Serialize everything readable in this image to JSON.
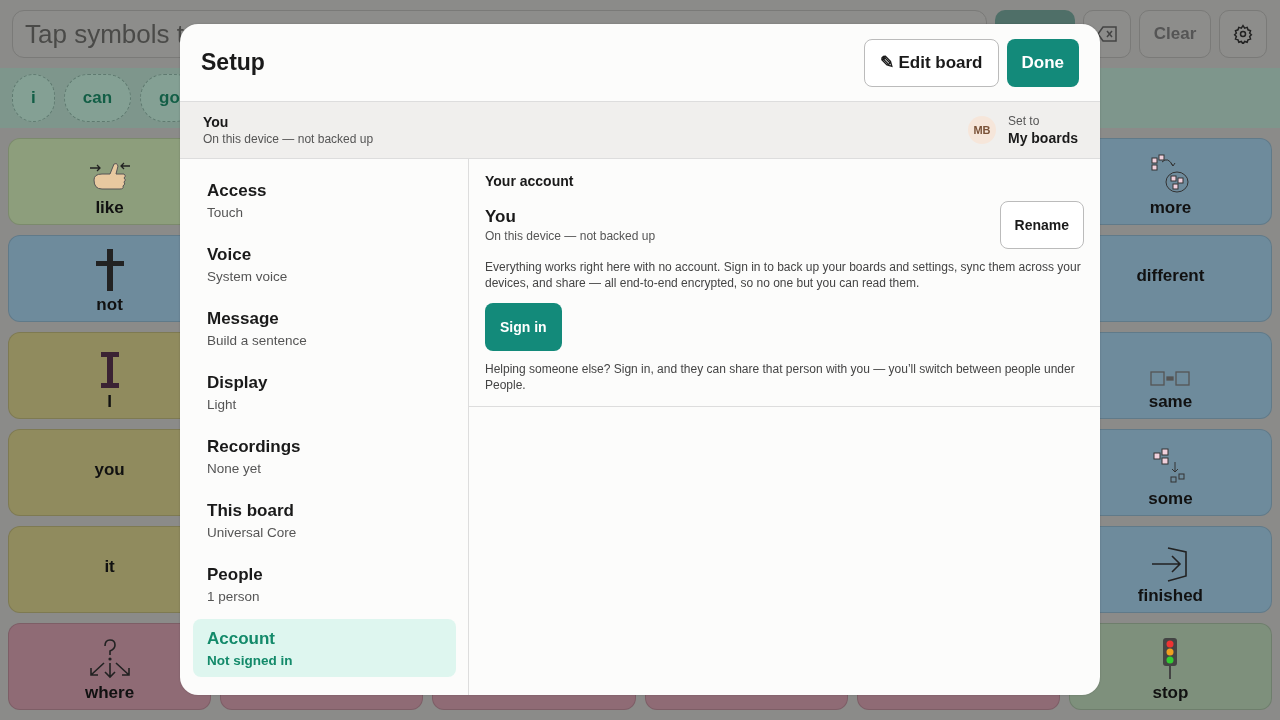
{
  "top_bar": {
    "message_placeholder": "Tap symbols t",
    "clear_button": "Clear"
  },
  "chips": [
    {
      "label": "i"
    },
    {
      "label": "can"
    },
    {
      "label": "go"
    }
  ],
  "board": {
    "rows": [
      {
        "tiles": [
          {
            "label": "like",
            "color": "#8d9e7c"
          },
          {
            "label": "more",
            "color": "#6e8b9c"
          }
        ]
      },
      {
        "tiles": [
          {
            "label": "not",
            "color": "#6e8b9c"
          },
          {
            "label": "different",
            "color": "#6e8b9c"
          }
        ]
      },
      {
        "tiles": [
          {
            "label": "I",
            "color": "#908b5e"
          },
          {
            "label": "same",
            "color": "#6e8b9c"
          }
        ]
      },
      {
        "tiles": [
          {
            "label": "you",
            "color": "#908b5e"
          },
          {
            "label": "some",
            "color": "#6e8b9c"
          }
        ]
      },
      {
        "tiles": [
          {
            "label": "it",
            "color": "#908b5e"
          },
          {
            "label": "finished",
            "color": "#6e8b9c"
          }
        ]
      },
      {
        "tiles": [
          {
            "label": "where",
            "color": "#8f6b75"
          },
          {
            "color": "#8f6b75"
          },
          {
            "color": "#8f6b75"
          },
          {
            "color": "#8f6b75"
          },
          {
            "color": "#8f6b75"
          },
          {
            "label": "stop",
            "color": "#7e907c"
          }
        ]
      }
    ]
  },
  "dialog": {
    "title": "Setup",
    "edit_button": {
      "icon": "✎",
      "label": "Edit board"
    },
    "done_button": "Done",
    "profile": {
      "name": "You",
      "status": "On this device — not backed up",
      "avatar": "MB",
      "set_to_label": "Set to",
      "set_to_value": "My boards"
    },
    "nav": [
      {
        "title": "Access",
        "subtitle": "Touch",
        "selected": false
      },
      {
        "title": "Voice",
        "subtitle": "System voice",
        "selected": false
      },
      {
        "title": "Message",
        "subtitle": "Build a sentence",
        "selected": false
      },
      {
        "title": "Display",
        "subtitle": "Light",
        "selected": false
      },
      {
        "title": "Recordings",
        "subtitle": "None yet",
        "selected": false
      },
      {
        "title": "This board",
        "subtitle": "Universal Core",
        "selected": false
      },
      {
        "title": "People",
        "subtitle": "1 person",
        "selected": false
      },
      {
        "title": "Account",
        "subtitle": "Not signed in",
        "selected": true
      }
    ],
    "account": {
      "heading": "Your account",
      "name": "You",
      "status": "On this device — not backed up",
      "rename_button": "Rename",
      "description": "Everything works right here with no account. Sign in to back up your boards and settings, sync them across your devices, and share — all end-to-end encrypted, so no one but you can read them.",
      "sign_in_button": "Sign in",
      "note": "Helping someone else? Sign in, and they can share that person with you — you’ll switch between people under People."
    }
  }
}
